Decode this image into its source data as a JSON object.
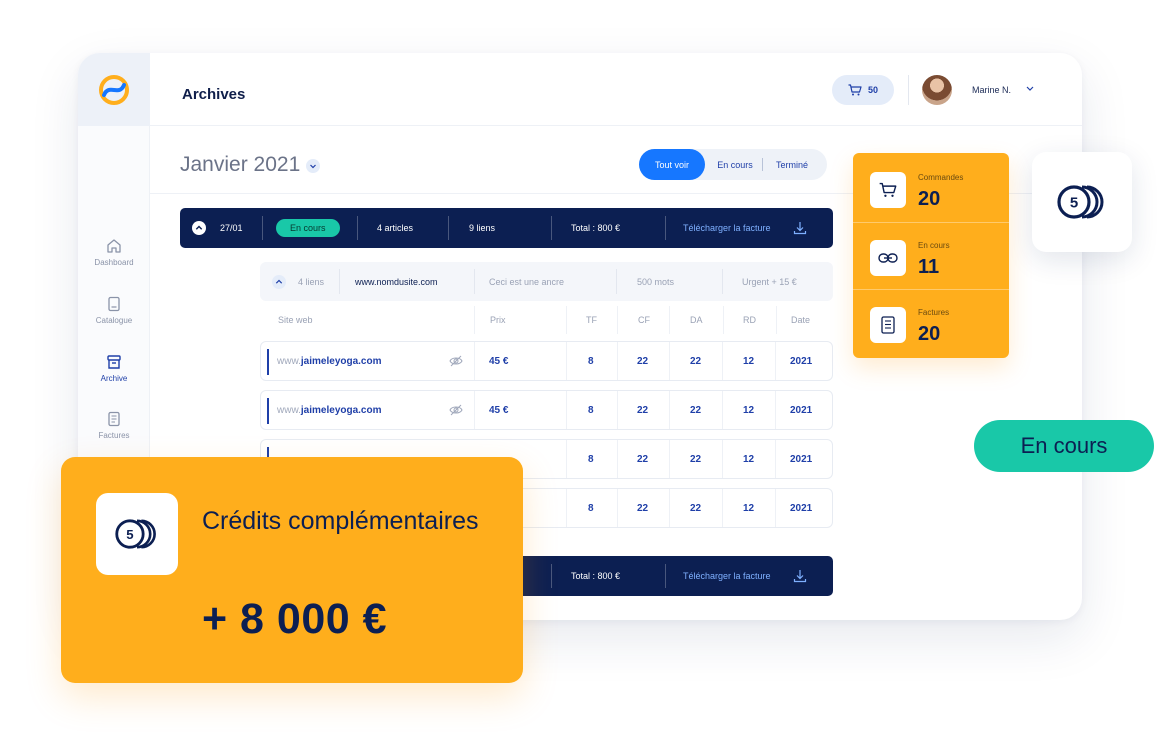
{
  "colors": {
    "navy": "#0c1f52",
    "blue": "#1677ff",
    "orange": "#ffae1c",
    "teal": "#19c8a8"
  },
  "sidebar": {
    "items": [
      {
        "label": "Dashboard",
        "icon": "home-icon"
      },
      {
        "label": "Catalogue",
        "icon": "book-icon"
      },
      {
        "label": "Archive",
        "icon": "archive-box-icon",
        "active": true
      },
      {
        "label": "Factures",
        "icon": "invoice-icon"
      }
    ]
  },
  "header": {
    "title": "Archives",
    "cart_count": "50",
    "user_name": "Marine N."
  },
  "main": {
    "month": "Janvier 2021",
    "filters": [
      "Tout voir",
      "En cours",
      "Terminé"
    ],
    "active_filter": "Tout voir",
    "order": {
      "date": "27/01",
      "status": "En cours",
      "articles": "4 articles",
      "links": "9 liens",
      "total": "Total : 800 €",
      "download": "Télécharger la facture"
    },
    "footer_order": {
      "total": "Total : 800 €",
      "download": "Télécharger la facture"
    },
    "sub_header": {
      "links": "4 liens",
      "site": "www.nomdusite.com",
      "anchor": "Ceci est une ancre",
      "words": "500 mots",
      "urgent": "Urgent + 15 €"
    },
    "columns": [
      "Site web",
      "Prix",
      "TF",
      "CF",
      "DA",
      "RD",
      "Date"
    ],
    "rows": [
      {
        "prefix": "www.",
        "domain": "jaimeleyoga.com",
        "price": "45 €",
        "tf": "8",
        "cf": "22",
        "da": "22",
        "rd": "12",
        "date": "2021"
      },
      {
        "prefix": "www.",
        "domain": "jaimeleyoga.com",
        "price": "45 €",
        "tf": "8",
        "cf": "22",
        "da": "22",
        "rd": "12",
        "date": "2021"
      },
      {
        "prefix": "",
        "domain": "",
        "price": "",
        "tf": "8",
        "cf": "22",
        "da": "22",
        "rd": "12",
        "date": "2021"
      },
      {
        "prefix": "",
        "domain": "",
        "price": "",
        "tf": "8",
        "cf": "22",
        "da": "22",
        "rd": "12",
        "date": "2021"
      }
    ]
  },
  "stats": [
    {
      "label": "Commandes",
      "value": "20",
      "icon": "cart-icon"
    },
    {
      "label": "En cours",
      "value": "11",
      "icon": "link-icon"
    },
    {
      "label": "Factures",
      "value": "20",
      "icon": "invoice-icon"
    }
  ],
  "coin_badge": "5",
  "status_pill": "En cours",
  "credit": {
    "title": "Crédits complémentaires",
    "amount": "+ 8 000 €",
    "coin": "5"
  }
}
